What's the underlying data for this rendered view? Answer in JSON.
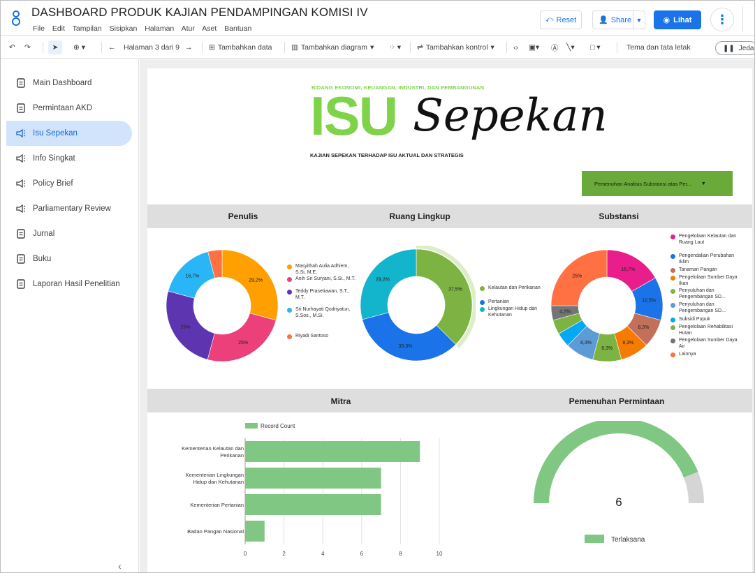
{
  "app": {
    "title": "DASHBOARD PRODUK KAJIAN PENDAMPINGAN KOMISI IV",
    "menu": [
      "File",
      "Edit",
      "Tampilan",
      "Sisipkan",
      "Halaman",
      "Atur",
      "Aset",
      "Bantuan"
    ],
    "reset_label": "Reset",
    "share_label": "Share",
    "view_label": "Lihat"
  },
  "toolbar": {
    "page_label": "Halaman 3 dari 9",
    "add_data": "Tambahkan data",
    "add_chart": "Tambahkan diagram",
    "add_control": "Tambahkan kontrol",
    "theme": "Tema dan tata letak",
    "pause": "Jeda"
  },
  "sidebar": {
    "items": [
      {
        "label": "Main Dashboard",
        "icon": "document-icon",
        "active": false
      },
      {
        "label": "Permintaan AKD",
        "icon": "document-icon",
        "active": false
      },
      {
        "label": "Isu Sepekan",
        "icon": "megaphone-icon",
        "active": true
      },
      {
        "label": "Info Singkat",
        "icon": "megaphone-icon",
        "active": false
      },
      {
        "label": "Policy Brief",
        "icon": "megaphone-icon",
        "active": false
      },
      {
        "label": "Parliamentary Review",
        "icon": "megaphone-icon",
        "active": false
      },
      {
        "label": "Jurnal",
        "icon": "document-icon",
        "active": false
      },
      {
        "label": "Buku",
        "icon": "document-icon",
        "active": false
      },
      {
        "label": "Laporan Hasil Penelitian",
        "icon": "document-icon",
        "active": false
      }
    ]
  },
  "banner": {
    "top_line": "BIDANG EKONOMI, KEUANGAN, INDUSTRI, DAN PEMBANGUNAN",
    "isu": "ISU",
    "sepekan": "Sepekan",
    "subtitle": "KAJIAN SEPEKAN TERHADAP ISU AKTUAL DAN STRATEGIS",
    "filter_label": "Pemenuhan Analisis Substansi atas Per..."
  },
  "sections": {
    "penulis": "Penulis",
    "ruang": "Ruang Lingkup",
    "substansi": "Substansi",
    "mitra": "Mitra",
    "pemenuhan": "Pemenuhan Permintaan"
  },
  "colors": {
    "accent": "#1a73e8",
    "green": "#7ed348",
    "bar": "#81c784"
  },
  "chart_data": [
    {
      "id": "penulis",
      "type": "pie",
      "title": "Penulis",
      "series": [
        {
          "name": "Masyithah Aulia Adhiem, S.Si, M.E.",
          "value": 29.2,
          "label": "29,2%",
          "color": "#ffa000"
        },
        {
          "name": "Anih Sri Suryani, S.Si., M.T.",
          "value": 25,
          "label": "25%",
          "color": "#ec407a"
        },
        {
          "name": "Teddy Prasetiawan, S.T., M.T.",
          "value": 25,
          "label": "25%",
          "color": "#5e35b1"
        },
        {
          "name": "Sri Nurhayati Qodriyatun, S.Sos., M.Si.",
          "value": 16.7,
          "label": "16,7%",
          "color": "#29b6f6"
        },
        {
          "name": "Riyadi Santoso",
          "value": 4.1,
          "label": "",
          "color": "#ff7043"
        }
      ]
    },
    {
      "id": "ruang",
      "type": "pie",
      "title": "Ruang Lingkup",
      "series": [
        {
          "name": "Kelautan dan Perikanan",
          "value": 37.5,
          "label": "37,5%",
          "color": "#7cb342"
        },
        {
          "name": "Pertanian",
          "value": 33.3,
          "label": "33,3%",
          "color": "#1a73e8"
        },
        {
          "name": "Lingkungan Hidup dan Kehutanan",
          "value": 29.2,
          "label": "29,2%",
          "color": "#12b5cb"
        }
      ]
    },
    {
      "id": "substansi",
      "type": "pie",
      "title": "Substansi",
      "series": [
        {
          "name": "Pengelolaan Kelautan dan Ruang Laut",
          "value": 16.7,
          "label": "16,7%",
          "color": "#e91e8c"
        },
        {
          "name": "Pengendalian Perubahan Iklim",
          "value": 12.5,
          "label": "12,5%",
          "color": "#1a73e8"
        },
        {
          "name": "Tanaman Pangan",
          "value": 8.3,
          "label": "8,3%",
          "color": "#c2705a"
        },
        {
          "name": "Pengelolaan Sumber Daya Ikan",
          "value": 8.3,
          "label": "8,3%",
          "color": "#f57c00"
        },
        {
          "name": "Penyuluhan dan Pengembangan SD...",
          "value": 8.3,
          "label": "8,3%",
          "color": "#7cb342"
        },
        {
          "name": "Penyuluhan dan Pengembangan SD...",
          "value": 8.3,
          "label": "8,3%",
          "color": "#5c9bd6"
        },
        {
          "name": "Subsidi Pupuk",
          "value": 4.2,
          "label": "",
          "color": "#03a9f4"
        },
        {
          "name": "Pengelolaan Rehabilitasi Hutan",
          "value": 4.2,
          "label": "",
          "color": "#7cb342"
        },
        {
          "name": "Pengelolaan Sumber Daya Air",
          "value": 4.2,
          "label": "4,2%",
          "color": "#757575"
        },
        {
          "name": "Lainnya",
          "value": 25,
          "label": "25%",
          "color": "#ff7043"
        }
      ]
    },
    {
      "id": "mitra",
      "type": "bar",
      "title": "Mitra",
      "legend": "Record Count",
      "categories": [
        "Kementerian Kelautan dan Perikanan",
        "Kementerian Lingkungan Hidup dan Kehutanan",
        "Kementerian Pertanian",
        "Badan Pangan Nasional"
      ],
      "values": [
        9,
        7,
        7,
        1
      ],
      "xlim": [
        0,
        10
      ],
      "ticks": [
        0,
        2,
        4,
        6,
        8,
        10
      ]
    },
    {
      "id": "pemenuhan",
      "type": "gauge",
      "title": "Pemenuhan Permintaan",
      "value": 6,
      "fill_fraction": 0.88,
      "legend": "Terlaksana"
    }
  ]
}
